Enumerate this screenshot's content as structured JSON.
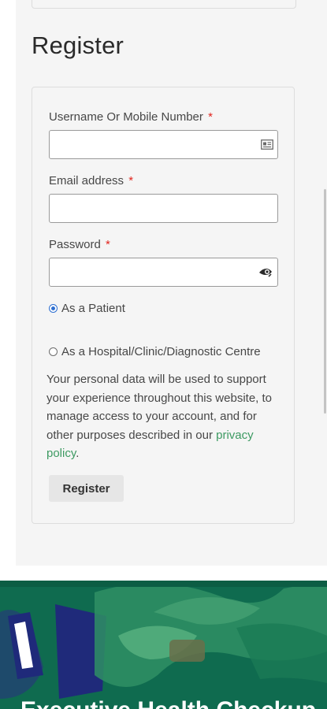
{
  "form": {
    "title": "Register",
    "required_mark": "*",
    "username_label": "Username Or Mobile Number",
    "email_label": "Email address",
    "password_label": "Password",
    "username_value": "",
    "email_value": "",
    "password_value": "",
    "account_types": [
      {
        "label": "As a Patient",
        "checked": true
      },
      {
        "label": "As a Hospital/Clinic/Diagnostic Centre",
        "checked": false
      }
    ],
    "privacy_text": "Your personal data will be used to support your experience throughout this website, to manage access to your account, and for other purposes described in our",
    "privacy_link": "privacy policy",
    "privacy_end": ".",
    "submit_label": "Register"
  },
  "banner": {
    "title": "Executive Health Checkup"
  },
  "colors": {
    "required": "#e2251e",
    "link": "#3d9a62",
    "radio_checked": "#2f6fd1",
    "banner_green": "#0f6b4f",
    "banner_navy": "#1f2a7a"
  },
  "icons": [
    "contact-card-icon",
    "password-reveal-icon"
  ]
}
